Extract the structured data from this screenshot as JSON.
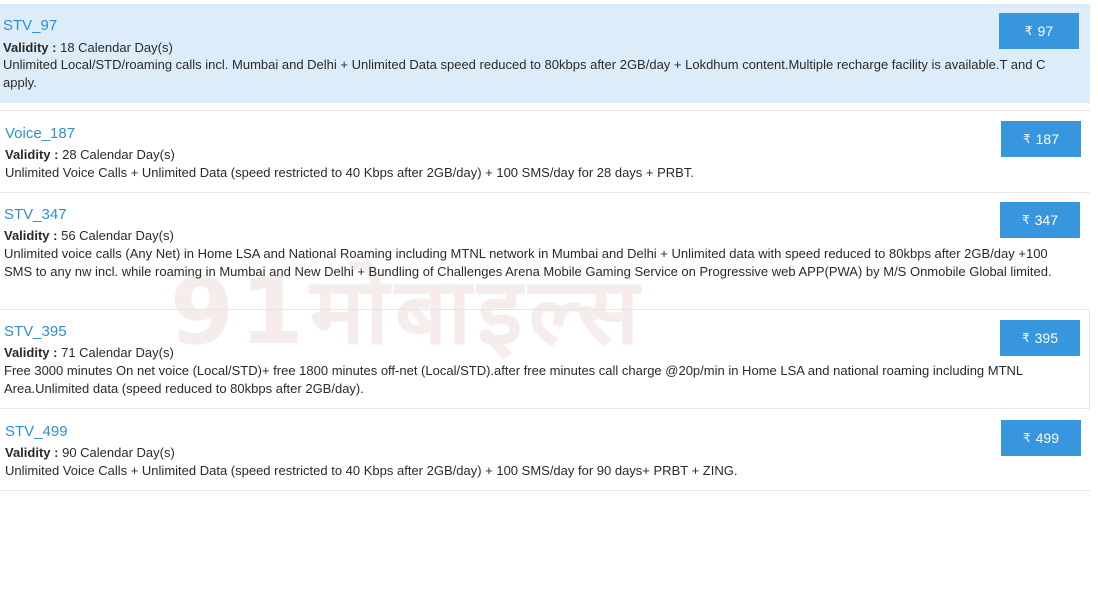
{
  "watermark": "91मोबाइल्स",
  "labels": {
    "validity": "Validity :"
  },
  "currency_symbol": "₹",
  "colors": {
    "link": "#2e8fd1",
    "button": "#3796dd",
    "highlight": "#dcecf8"
  },
  "plans": [
    {
      "name": "STV_97",
      "validity": "18 Calendar Day(s)",
      "description": "Unlimited Local/STD/roaming calls incl. Mumbai and Delhi + Unlimited Data speed reduced to 80kbps after 2GB/day + Lokdhum content.Multiple recharge facility is available.T and C apply.",
      "price": "97",
      "highlighted": true
    },
    {
      "name": "Voice_187",
      "validity": "28 Calendar Day(s)",
      "description": "Unlimited Voice Calls + Unlimited Data (speed restricted to 40 Kbps after 2GB/day) + 100 SMS/day for 28 days + PRBT.",
      "price": "187",
      "highlighted": false
    },
    {
      "name": "STV_347",
      "validity": "56 Calendar Day(s)",
      "description": "Unlimited voice calls (Any Net) in Home LSA and National Roaming including MTNL network in Mumbai and Delhi + Unlimited data with speed reduced to 80kbps after 2GB/day +100 SMS to any nw incl. while roaming in Mumbai and New Delhi + Bundling of Challenges Arena Mobile Gaming Service on Progressive web APP(PWA) by M/S Onmobile Global limited.",
      "price": "347",
      "highlighted": false
    },
    {
      "name": "STV_395",
      "validity": "71 Calendar Day(s)",
      "description": "Free 3000 minutes On net voice (Local/STD)+ free 1800 minutes off-net (Local/STD).after free minutes call charge @20p/min in Home LSA and national roaming including MTNL Area.Unlimited data (speed reduced to 80kbps after 2GB/day).",
      "price": "395",
      "highlighted": false
    },
    {
      "name": "STV_499",
      "validity": "90 Calendar Day(s)",
      "description": "Unlimited Voice Calls + Unlimited Data (speed restricted to 40 Kbps after 2GB/day) + 100 SMS/day for 90 days+ PRBT + ZING.",
      "price": "499",
      "highlighted": false
    }
  ]
}
